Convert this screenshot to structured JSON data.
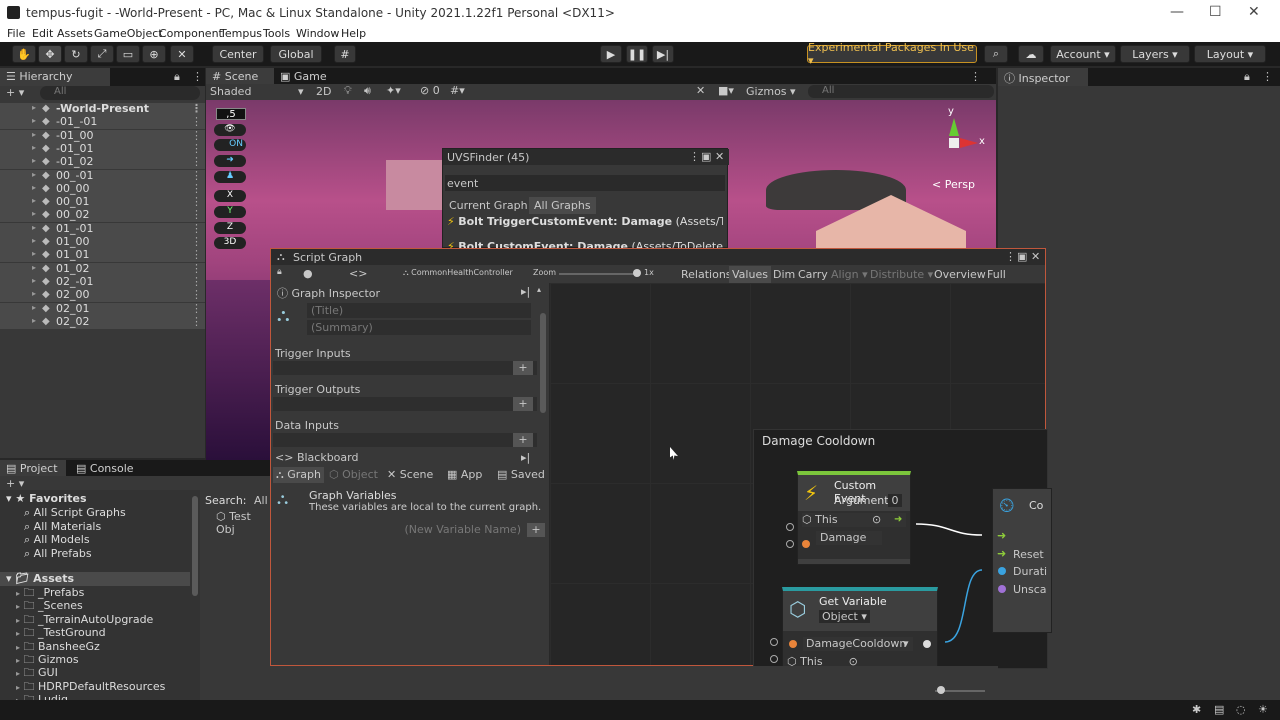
{
  "window": {
    "title": "tempus-fugit - -World-Present - PC, Mac & Linux Standalone - Unity 2021.1.22f1 Personal <DX11>"
  },
  "menu": [
    "File",
    "Edit",
    "Assets",
    "GameObject",
    "Component",
    "Tempus",
    "Tools",
    "Window",
    "Help"
  ],
  "toolbar": {
    "center": "Center",
    "global": "Global",
    "experimental": "Experimental Packages In Use ▾",
    "account": "Account",
    "layers": "Layers",
    "layout": "Layout"
  },
  "hierarchy": {
    "tab": "Hierarchy",
    "search": "All",
    "items": [
      {
        "name": "-World-Present",
        "bold": true
      },
      {
        "name": "-01_-01"
      },
      {
        "name": "-01_00"
      },
      {
        "name": "-01_01"
      },
      {
        "name": "-01_02"
      },
      {
        "name": "00_-01"
      },
      {
        "name": "00_00"
      },
      {
        "name": "00_01"
      },
      {
        "name": "00_02"
      },
      {
        "name": "01_-01"
      },
      {
        "name": "01_00"
      },
      {
        "name": "01_01"
      },
      {
        "name": "01_02"
      },
      {
        "name": "02_-01"
      },
      {
        "name": "02_00"
      },
      {
        "name": "02_01"
      },
      {
        "name": "02_02"
      }
    ]
  },
  "scene": {
    "tabs": [
      "Scene",
      "Game"
    ],
    "shading": "Shaded",
    "mode2d": "2D",
    "gizmos": "Gizmos",
    "search": "All",
    "persp": "< Persp",
    "hidden_count": "0",
    "overlay_value": ",5",
    "on_label": "ON",
    "axes": {
      "x": "x",
      "y": "y"
    }
  },
  "uvsfinder": {
    "title": "UVSFinder (45)",
    "search": "event",
    "tab_current": "Current Graph",
    "tab_all": "All Graphs",
    "result1_a": "Bolt TriggerCustomEvent: Damage",
    "result1_b": " (Assets/ToDele",
    "result2_a": "Bolt CustomEvent: Damage",
    "result2_b": " (Assets/ToDeleteFinalf"
  },
  "scriptgraph": {
    "title": "Script Graph",
    "breadcrumb": "CommonHealthController",
    "zoom_label": "Zoom",
    "zoom_value": "1x",
    "buttons": [
      "Relations",
      "Values",
      "Dim",
      "Carry",
      "Align ▾",
      "Distribute ▾",
      "Overview",
      "Full Screen"
    ]
  },
  "graph_inspector": {
    "title": "Graph Inspector",
    "title_placeholder": "(Title)",
    "summary_placeholder": "(Summary)",
    "trigger_inputs": "Trigger Inputs",
    "trigger_outputs": "Trigger Outputs",
    "data_inputs": "Data Inputs"
  },
  "blackboard": {
    "title": "Blackboard",
    "tabs": [
      "Graph",
      "Object",
      "Scene",
      "App",
      "Saved"
    ],
    "vars_title": "Graph Variables",
    "vars_desc": "These variables are local to the current graph.",
    "new_var_placeholder": "(New Variable Name)"
  },
  "group": {
    "title": "Damage Cooldown"
  },
  "custom_event": {
    "title": "Custom Event",
    "args_label": "Arguments",
    "args_value": "0",
    "this_label": "This",
    "damage_label": "Damage"
  },
  "get_variable": {
    "title": "Get Variable",
    "kind": "Object ▾",
    "var_name": "DamageCooldown",
    "this_label": "This"
  },
  "cooldown": {
    "title": "Co",
    "reset": "Reset",
    "duration": "Durati",
    "unscaled": "Unsca"
  },
  "project": {
    "tabs": [
      "Project",
      "Console"
    ],
    "favorites": "Favorites",
    "fav_items": [
      "All Script Graphs",
      "All Materials",
      "All Models",
      "All Prefabs"
    ],
    "assets": "Assets",
    "asset_items": [
      "_Prefabs",
      "_Scenes",
      "_TerrainAutoUpgrade",
      "_TestGround",
      "BansheeGz",
      "Gizmos",
      "GUI",
      "HDRPDefaultResources",
      "Ludiq"
    ],
    "search_label": "Search:",
    "search_scope": "All",
    "result": "Test Obj"
  },
  "inspector": {
    "tab": "Inspector"
  }
}
